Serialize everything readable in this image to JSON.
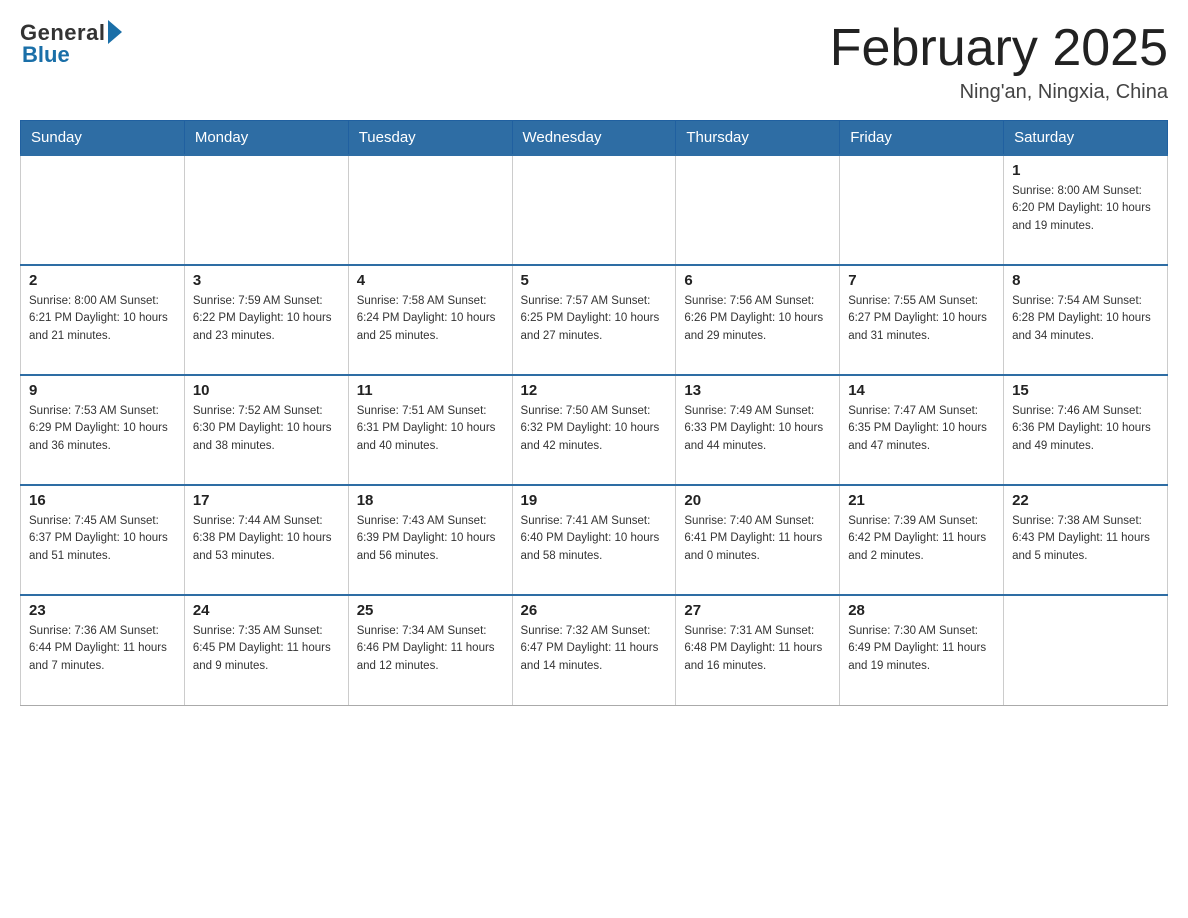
{
  "logo": {
    "general": "General",
    "blue": "Blue"
  },
  "title": "February 2025",
  "location": "Ning'an, Ningxia, China",
  "weekdays": [
    "Sunday",
    "Monday",
    "Tuesday",
    "Wednesday",
    "Thursday",
    "Friday",
    "Saturday"
  ],
  "weeks": [
    [
      {
        "day": "",
        "info": ""
      },
      {
        "day": "",
        "info": ""
      },
      {
        "day": "",
        "info": ""
      },
      {
        "day": "",
        "info": ""
      },
      {
        "day": "",
        "info": ""
      },
      {
        "day": "",
        "info": ""
      },
      {
        "day": "1",
        "info": "Sunrise: 8:00 AM\nSunset: 6:20 PM\nDaylight: 10 hours\nand 19 minutes."
      }
    ],
    [
      {
        "day": "2",
        "info": "Sunrise: 8:00 AM\nSunset: 6:21 PM\nDaylight: 10 hours\nand 21 minutes."
      },
      {
        "day": "3",
        "info": "Sunrise: 7:59 AM\nSunset: 6:22 PM\nDaylight: 10 hours\nand 23 minutes."
      },
      {
        "day": "4",
        "info": "Sunrise: 7:58 AM\nSunset: 6:24 PM\nDaylight: 10 hours\nand 25 minutes."
      },
      {
        "day": "5",
        "info": "Sunrise: 7:57 AM\nSunset: 6:25 PM\nDaylight: 10 hours\nand 27 minutes."
      },
      {
        "day": "6",
        "info": "Sunrise: 7:56 AM\nSunset: 6:26 PM\nDaylight: 10 hours\nand 29 minutes."
      },
      {
        "day": "7",
        "info": "Sunrise: 7:55 AM\nSunset: 6:27 PM\nDaylight: 10 hours\nand 31 minutes."
      },
      {
        "day": "8",
        "info": "Sunrise: 7:54 AM\nSunset: 6:28 PM\nDaylight: 10 hours\nand 34 minutes."
      }
    ],
    [
      {
        "day": "9",
        "info": "Sunrise: 7:53 AM\nSunset: 6:29 PM\nDaylight: 10 hours\nand 36 minutes."
      },
      {
        "day": "10",
        "info": "Sunrise: 7:52 AM\nSunset: 6:30 PM\nDaylight: 10 hours\nand 38 minutes."
      },
      {
        "day": "11",
        "info": "Sunrise: 7:51 AM\nSunset: 6:31 PM\nDaylight: 10 hours\nand 40 minutes."
      },
      {
        "day": "12",
        "info": "Sunrise: 7:50 AM\nSunset: 6:32 PM\nDaylight: 10 hours\nand 42 minutes."
      },
      {
        "day": "13",
        "info": "Sunrise: 7:49 AM\nSunset: 6:33 PM\nDaylight: 10 hours\nand 44 minutes."
      },
      {
        "day": "14",
        "info": "Sunrise: 7:47 AM\nSunset: 6:35 PM\nDaylight: 10 hours\nand 47 minutes."
      },
      {
        "day": "15",
        "info": "Sunrise: 7:46 AM\nSunset: 6:36 PM\nDaylight: 10 hours\nand 49 minutes."
      }
    ],
    [
      {
        "day": "16",
        "info": "Sunrise: 7:45 AM\nSunset: 6:37 PM\nDaylight: 10 hours\nand 51 minutes."
      },
      {
        "day": "17",
        "info": "Sunrise: 7:44 AM\nSunset: 6:38 PM\nDaylight: 10 hours\nand 53 minutes."
      },
      {
        "day": "18",
        "info": "Sunrise: 7:43 AM\nSunset: 6:39 PM\nDaylight: 10 hours\nand 56 minutes."
      },
      {
        "day": "19",
        "info": "Sunrise: 7:41 AM\nSunset: 6:40 PM\nDaylight: 10 hours\nand 58 minutes."
      },
      {
        "day": "20",
        "info": "Sunrise: 7:40 AM\nSunset: 6:41 PM\nDaylight: 11 hours\nand 0 minutes."
      },
      {
        "day": "21",
        "info": "Sunrise: 7:39 AM\nSunset: 6:42 PM\nDaylight: 11 hours\nand 2 minutes."
      },
      {
        "day": "22",
        "info": "Sunrise: 7:38 AM\nSunset: 6:43 PM\nDaylight: 11 hours\nand 5 minutes."
      }
    ],
    [
      {
        "day": "23",
        "info": "Sunrise: 7:36 AM\nSunset: 6:44 PM\nDaylight: 11 hours\nand 7 minutes."
      },
      {
        "day": "24",
        "info": "Sunrise: 7:35 AM\nSunset: 6:45 PM\nDaylight: 11 hours\nand 9 minutes."
      },
      {
        "day": "25",
        "info": "Sunrise: 7:34 AM\nSunset: 6:46 PM\nDaylight: 11 hours\nand 12 minutes."
      },
      {
        "day": "26",
        "info": "Sunrise: 7:32 AM\nSunset: 6:47 PM\nDaylight: 11 hours\nand 14 minutes."
      },
      {
        "day": "27",
        "info": "Sunrise: 7:31 AM\nSunset: 6:48 PM\nDaylight: 11 hours\nand 16 minutes."
      },
      {
        "day": "28",
        "info": "Sunrise: 7:30 AM\nSunset: 6:49 PM\nDaylight: 11 hours\nand 19 minutes."
      },
      {
        "day": "",
        "info": ""
      }
    ]
  ]
}
